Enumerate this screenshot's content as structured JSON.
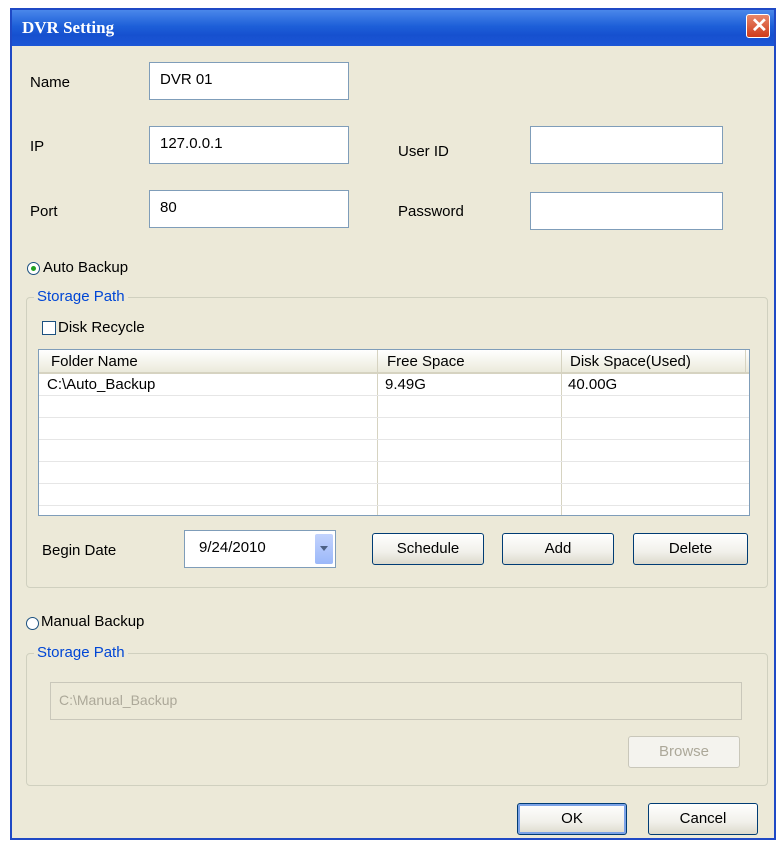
{
  "window": {
    "title": "DVR Setting"
  },
  "fields": {
    "name_label": "Name",
    "name_value": "DVR 01",
    "ip_label": "IP",
    "ip_value": "127.0.0.1",
    "port_label": "Port",
    "port_value": "80",
    "userid_label": "User ID",
    "userid_value": "",
    "password_label": "Password",
    "password_value": ""
  },
  "auto_backup": {
    "label": "Auto Backup",
    "selected": true,
    "storage_path_legend": "Storage Path",
    "disk_recycle_label": "Disk Recycle",
    "disk_recycle_checked": false,
    "table": {
      "headers": [
        "Folder Name",
        "Free Space",
        "Disk Space(Used)"
      ],
      "rows": [
        [
          "C:\\Auto_Backup",
          "9.49G",
          "40.00G"
        ]
      ]
    },
    "begin_date_label": "Begin Date",
    "begin_date_value": "9/24/2010",
    "schedule_button": "Schedule",
    "add_button": "Add",
    "delete_button": "Delete"
  },
  "manual_backup": {
    "label": "Manual Backup",
    "selected": false,
    "storage_path_legend": "Storage Path",
    "path_value": "C:\\Manual_Backup",
    "browse_button": "Browse"
  },
  "footer": {
    "ok_button": "OK",
    "cancel_button": "Cancel"
  },
  "colors": {
    "title_bar": "#1d5fd8",
    "legend_text": "#0046d5",
    "dialog_bg": "#ece9d8"
  }
}
